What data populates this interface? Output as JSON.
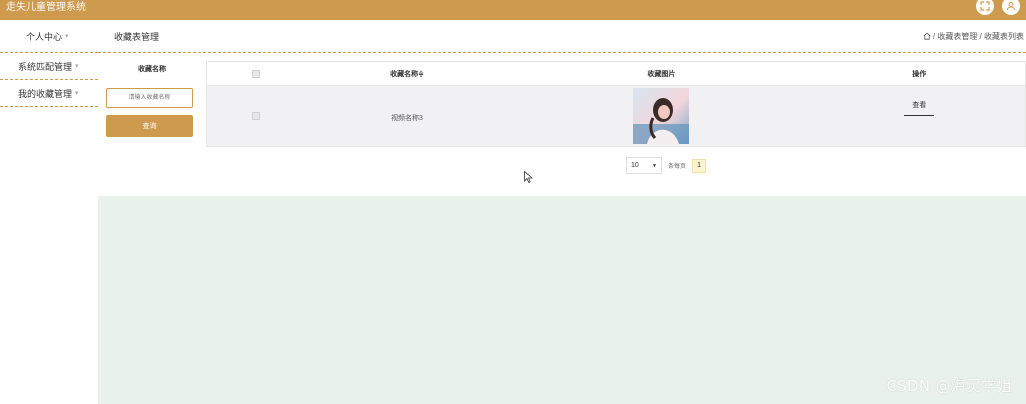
{
  "app": {
    "title": "走失儿童管理系统"
  },
  "colors": {
    "accent": "#cd9a4e",
    "content_bg": "#e8f1ec",
    "row_bg": "#f1f1f4"
  },
  "sidebar": {
    "items": [
      {
        "label": "个人中心",
        "icon": "chevron-down-icon"
      },
      {
        "label": "系统匹配管理",
        "icon": "chevron-down-icon"
      },
      {
        "label": "我的收藏管理",
        "icon": "chevron-down-icon"
      }
    ]
  },
  "page": {
    "title": "收藏表管理",
    "breadcrumb": " / 收藏表管理 / 收藏表列表"
  },
  "search": {
    "label": "收藏名称",
    "placeholder": "请输入收藏名称",
    "button": "查询"
  },
  "table": {
    "headers": {
      "name": "收藏名称≑",
      "image": "收藏图片",
      "op": "操作"
    },
    "rows": [
      {
        "name": "视频名称3",
        "op": "查看"
      }
    ]
  },
  "pager": {
    "page_size": "10",
    "per_page_label": "条每页",
    "current_page": "1"
  },
  "watermark": "CSDN @海灵学姐"
}
